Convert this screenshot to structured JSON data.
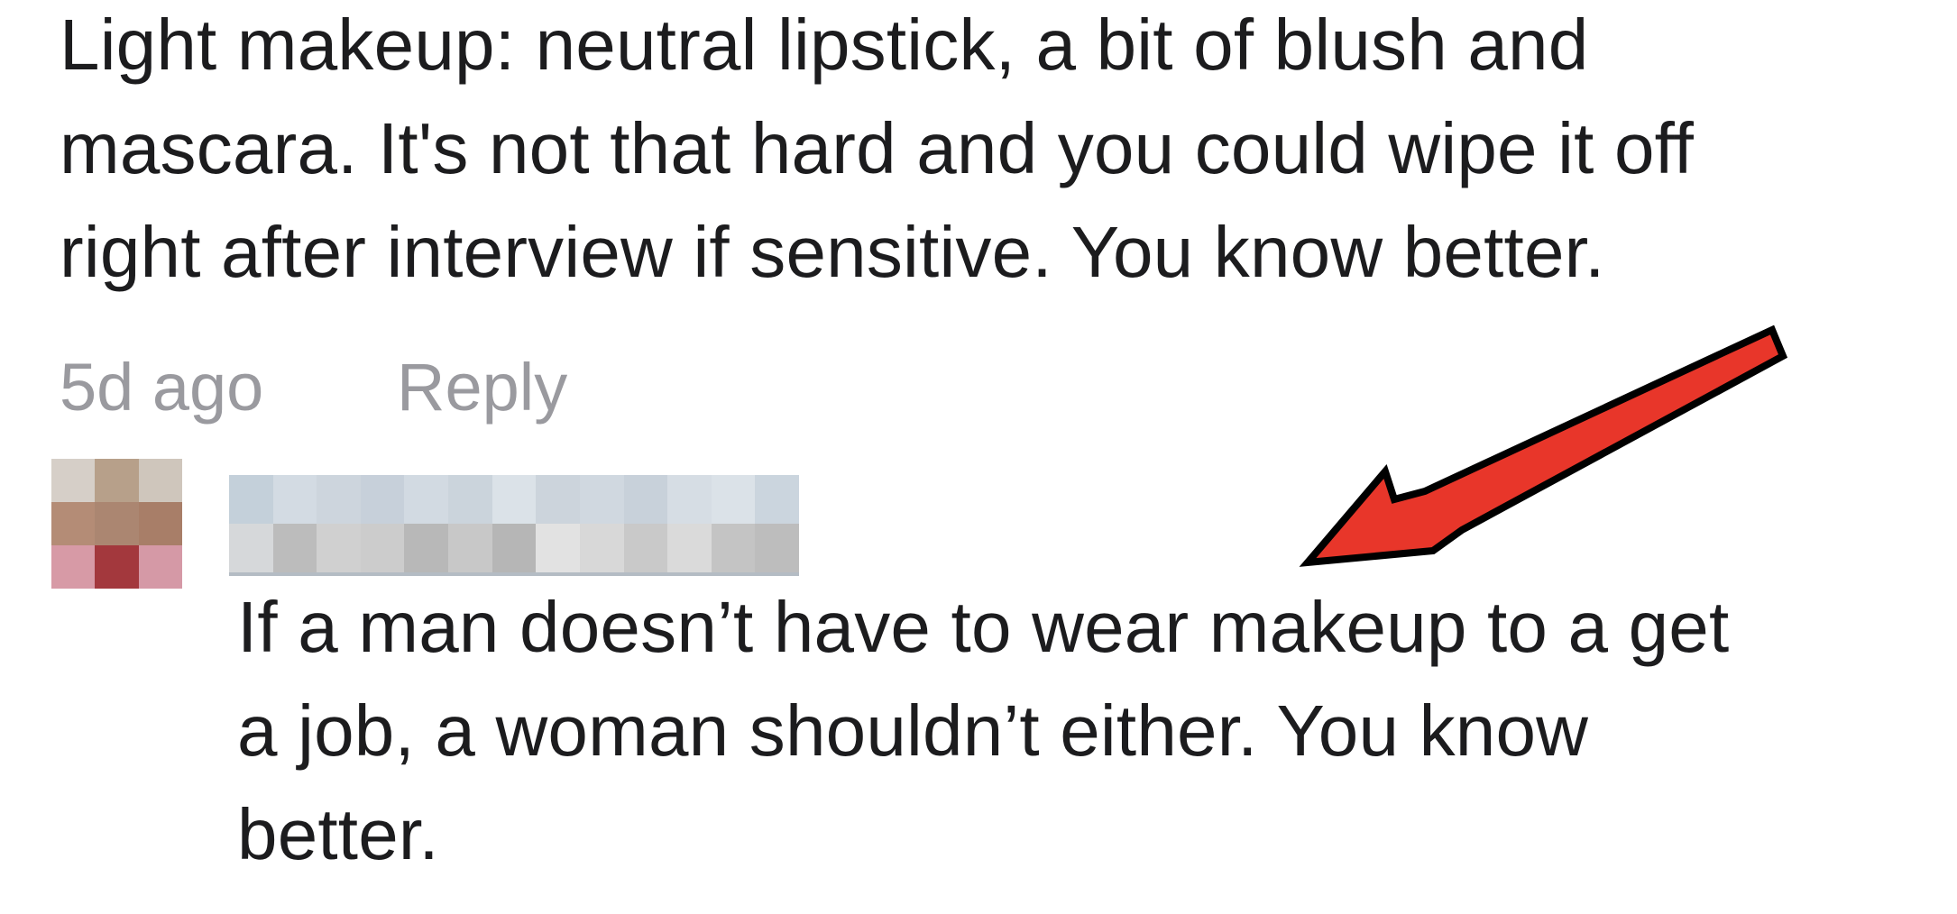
{
  "comments": [
    {
      "text": "Light makeup: neutral lipstick, a bit of blush and\nmascara. It's not that hard and you could wipe it off\nright after interview if sensitive. You know better.",
      "timestamp": "5d ago",
      "reply_label": "Reply"
    },
    {
      "text": "If a man doesn’t have to wear makeup to a get\na job, a woman shouldn’t either. You know\nbetter."
    }
  ],
  "colors": {
    "text": "#1c1c1e",
    "meta": "#9a9a9f",
    "arrow_fill": "#e8362a",
    "arrow_outline": "#000000"
  },
  "icons": {
    "arrow": "red-arrow-annotation"
  }
}
